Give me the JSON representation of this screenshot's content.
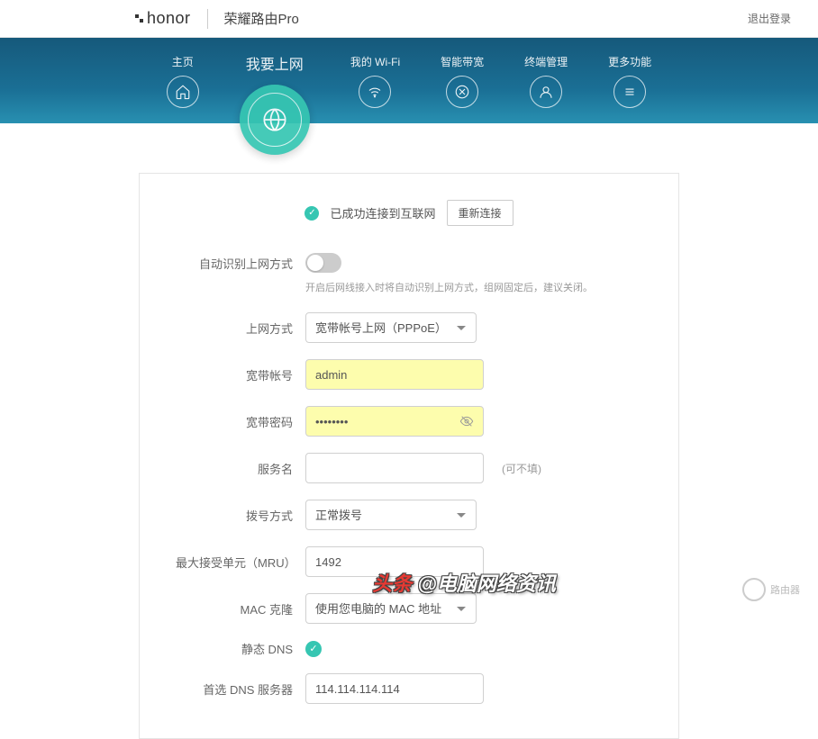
{
  "brand": {
    "logo": "honor",
    "name": "荣耀路由Pro"
  },
  "logout": "退出登录",
  "nav": {
    "home": "主页",
    "internet": "我要上网",
    "wifi": "我的 Wi-Fi",
    "bandwidth": "智能带宽",
    "terminal": "终端管理",
    "more": "更多功能"
  },
  "status": {
    "text": "已成功连接到互联网",
    "reconnect": "重新连接"
  },
  "form": {
    "auto_label": "自动识别上网方式",
    "auto_desc": "开启后网线接入时将自动识别上网方式，组网固定后，建议关闭。",
    "mode_label": "上网方式",
    "mode_value": "宽带帐号上网（PPPoE）",
    "user_label": "宽带帐号",
    "user_value": "admin",
    "pass_label": "宽带密码",
    "pass_value": "••••••••",
    "service_label": "服务名",
    "service_value": "",
    "service_hint": "(可不填)",
    "dial_label": "拨号方式",
    "dial_value": "正常拨号",
    "mru_label": "最大接受单元（MRU）",
    "mru_value": "1492",
    "mac_label": "MAC 克隆",
    "mac_value": "使用您电脑的 MAC 地址",
    "dns_label": "静态 DNS",
    "dns1_label": "首选 DNS 服务器",
    "dns1_value": "114.114.114.114"
  },
  "watermark": {
    "brand": "路由器",
    "toutiao_head": "头条",
    "toutiao_at": "@电脑网络资讯"
  }
}
